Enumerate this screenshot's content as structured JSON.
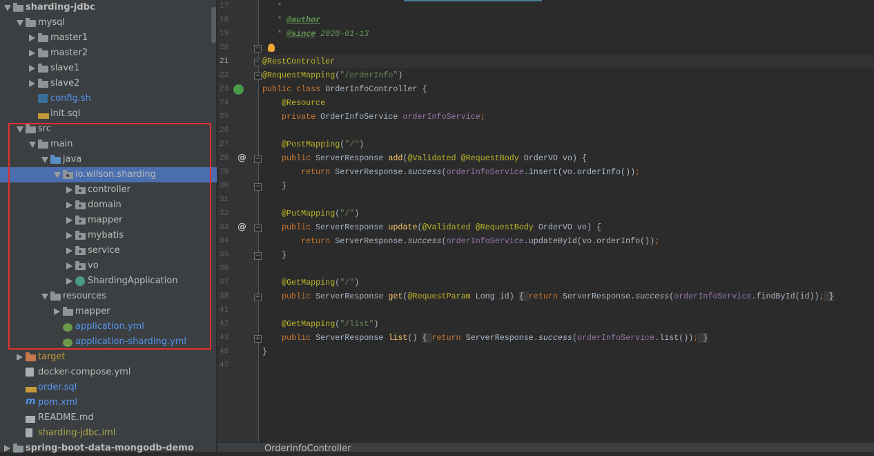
{
  "project_tree": [
    {
      "label": "sharding-jdbc",
      "level": 0,
      "arrow": "open",
      "icon": "module-folder",
      "color": "#bbbbbb",
      "bold": true
    },
    {
      "label": "mysql",
      "level": 1,
      "arrow": "open",
      "icon": "folder",
      "color": "#bbbbbb"
    },
    {
      "label": "master1",
      "level": 2,
      "arrow": "closed",
      "icon": "folder",
      "color": "#bbbbbb"
    },
    {
      "label": "master2",
      "level": 2,
      "arrow": "closed",
      "icon": "folder",
      "color": "#bbbbbb"
    },
    {
      "label": "slave1",
      "level": 2,
      "arrow": "closed",
      "icon": "folder",
      "color": "#bbbbbb"
    },
    {
      "label": "slave2",
      "level": 2,
      "arrow": "closed",
      "icon": "folder",
      "color": "#bbbbbb"
    },
    {
      "label": "config.sh",
      "level": 2,
      "arrow": "none",
      "icon": "shell-file",
      "color": "#5394ec"
    },
    {
      "label": "init.sql",
      "level": 2,
      "arrow": "none",
      "icon": "sql-file",
      "color": "#bbbbbb"
    },
    {
      "label": "src",
      "level": 1,
      "arrow": "open",
      "icon": "folder",
      "color": "#bbbbbb"
    },
    {
      "label": "main",
      "level": 2,
      "arrow": "open",
      "icon": "folder",
      "color": "#bbbbbb"
    },
    {
      "label": "java",
      "level": 3,
      "arrow": "open",
      "icon": "source-folder",
      "color": "#bbbbbb"
    },
    {
      "label": "io.wilson.sharding",
      "level": 4,
      "arrow": "open",
      "icon": "package",
      "color": "#bbbbbb",
      "selected": true
    },
    {
      "label": "controller",
      "level": 5,
      "arrow": "closed",
      "icon": "package",
      "color": "#bbbbbb"
    },
    {
      "label": "domain",
      "level": 5,
      "arrow": "closed",
      "icon": "package",
      "color": "#bbbbbb"
    },
    {
      "label": "mapper",
      "level": 5,
      "arrow": "closed",
      "icon": "package",
      "color": "#bbbbbb"
    },
    {
      "label": "mybatis",
      "level": 5,
      "arrow": "closed",
      "icon": "package",
      "color": "#bbbbbb"
    },
    {
      "label": "service",
      "level": 5,
      "arrow": "closed",
      "icon": "package",
      "color": "#bbbbbb"
    },
    {
      "label": "vo",
      "level": 5,
      "arrow": "closed",
      "icon": "package",
      "color": "#bbbbbb"
    },
    {
      "label": "ShardingApplication",
      "level": 5,
      "arrow": "closed",
      "icon": "spring-boot-class",
      "color": "#bbbbbb"
    },
    {
      "label": "resources",
      "level": 3,
      "arrow": "open",
      "icon": "resources-folder",
      "color": "#bbbbbb"
    },
    {
      "label": "mapper",
      "level": 4,
      "arrow": "closed",
      "icon": "folder",
      "color": "#bbbbbb"
    },
    {
      "label": "application.yml",
      "level": 4,
      "arrow": "none",
      "icon": "yml-file",
      "color": "#5394ec"
    },
    {
      "label": "application-sharding.yml",
      "level": 4,
      "arrow": "none",
      "icon": "yml-file",
      "color": "#5394ec"
    },
    {
      "label": "target",
      "level": 1,
      "arrow": "closed",
      "icon": "excluded-folder",
      "color": "#c49a3a"
    },
    {
      "label": "docker-compose.yml",
      "level": 1,
      "arrow": "none",
      "icon": "docker-compose-file",
      "color": "#bbbbbb"
    },
    {
      "label": "order.sql",
      "level": 1,
      "arrow": "none",
      "icon": "sql-file",
      "color": "#5394ec"
    },
    {
      "label": "pom.xml",
      "level": 1,
      "arrow": "none",
      "icon": "maven-file",
      "color": "#5394ec"
    },
    {
      "label": "README.md",
      "level": 1,
      "arrow": "none",
      "icon": "markdown-file",
      "color": "#bbbbbb"
    },
    {
      "label": "sharding-jdbc.iml",
      "level": 1,
      "arrow": "none",
      "icon": "iml-file",
      "color": "#a8a84a"
    },
    {
      "label": "spring-boot-data-mongodb-demo",
      "level": 0,
      "arrow": "closed",
      "icon": "module-folder",
      "color": "#bbbbbb",
      "bold": true
    }
  ],
  "editor": {
    "current_line": "21",
    "lines": [
      {
        "n": "17",
        "t": [
          [
            "   *",
            "c"
          ]
        ]
      },
      {
        "n": "18",
        "t": [
          [
            "   * ",
            "c"
          ],
          [
            "@author",
            "ct"
          ]
        ]
      },
      {
        "n": "19",
        "t": [
          [
            "   * ",
            "c"
          ],
          [
            "@since",
            "ct"
          ],
          [
            " 2020-01-13",
            "c"
          ]
        ]
      },
      {
        "n": "20",
        "t": [],
        "fold": "-",
        "gicon": "intention-bulb-icon"
      },
      {
        "n": "21",
        "t": [
          [
            "@RestController",
            "a"
          ]
        ],
        "fold": "-"
      },
      {
        "n": "22",
        "t": [
          [
            "@RequestMapping",
            "a"
          ],
          [
            "(",
            ""
          ],
          [
            "\"/orderInfo\"",
            "s"
          ],
          [
            ")",
            ""
          ]
        ],
        "fold": "-"
      },
      {
        "n": "23",
        "t": [
          [
            "public class ",
            "k"
          ],
          [
            "OrderInfoController {",
            ""
          ]
        ],
        "gicon": "spring-bean-icon"
      },
      {
        "n": "24",
        "t": [
          [
            "    @Resource",
            "a"
          ]
        ]
      },
      {
        "n": "25",
        "t": [
          [
            "    private ",
            "k"
          ],
          [
            "OrderInfoService ",
            ""
          ],
          [
            "orderInfoService",
            "f"
          ],
          [
            ";",
            "k"
          ]
        ]
      },
      {
        "n": "26",
        "t": []
      },
      {
        "n": "27",
        "t": [
          [
            "    @PostMapping",
            "a"
          ],
          [
            "(",
            ""
          ],
          [
            "\"/\"",
            "s"
          ],
          [
            ")",
            ""
          ]
        ]
      },
      {
        "n": "28",
        "t": [
          [
            "    public ",
            "k"
          ],
          [
            "ServerResponse ",
            ""
          ],
          [
            "add",
            "m"
          ],
          [
            "(",
            ""
          ],
          [
            "@Validated @RequestBody",
            "a"
          ],
          [
            " OrderVO vo) {",
            ""
          ]
        ],
        "fold": "-",
        "gicon": "at-mapping-icon"
      },
      {
        "n": "29",
        "t": [
          [
            "        return ",
            "k"
          ],
          [
            "ServerResponse.",
            ""
          ],
          [
            "success",
            "i"
          ],
          [
            "(",
            ""
          ],
          [
            "orderInfoService",
            "f"
          ],
          [
            ".insert(vo.orderInfo())",
            ""
          ],
          [
            ";",
            "k"
          ]
        ]
      },
      {
        "n": "30",
        "t": [
          [
            "    }",
            ""
          ]
        ],
        "fold": "-"
      },
      {
        "n": "31",
        "t": []
      },
      {
        "n": "32",
        "t": [
          [
            "    @PutMapping",
            "a"
          ],
          [
            "(",
            ""
          ],
          [
            "\"/\"",
            "s"
          ],
          [
            ")",
            ""
          ]
        ]
      },
      {
        "n": "33",
        "t": [
          [
            "    public ",
            "k"
          ],
          [
            "ServerResponse ",
            ""
          ],
          [
            "update",
            "m"
          ],
          [
            "(",
            ""
          ],
          [
            "@Validated @RequestBody",
            "a"
          ],
          [
            " OrderVO vo) {",
            ""
          ]
        ],
        "fold": "-",
        "gicon": "at-mapping-icon"
      },
      {
        "n": "34",
        "t": [
          [
            "        return ",
            "k"
          ],
          [
            "ServerResponse.",
            ""
          ],
          [
            "success",
            "i"
          ],
          [
            "(",
            ""
          ],
          [
            "orderInfoService",
            "f"
          ],
          [
            ".updateById(vo.orderInfo())",
            ""
          ],
          [
            ";",
            "k"
          ]
        ]
      },
      {
        "n": "35",
        "t": [
          [
            "    }",
            ""
          ]
        ],
        "fold": "-"
      },
      {
        "n": "36",
        "t": []
      },
      {
        "n": "37",
        "t": [
          [
            "    @GetMapping",
            "a"
          ],
          [
            "(",
            ""
          ],
          [
            "\"/\"",
            "s"
          ],
          [
            ")",
            ""
          ]
        ]
      },
      {
        "n": "38",
        "t": [
          [
            "    public ",
            "k"
          ],
          [
            "ServerResponse ",
            ""
          ],
          [
            "get",
            "m"
          ],
          [
            "(",
            ""
          ],
          [
            "@RequestParam",
            "a"
          ],
          [
            " Long id) ",
            ""
          ],
          [
            "{ ",
            "b"
          ],
          [
            "return ",
            "k"
          ],
          [
            "ServerResponse.",
            ""
          ],
          [
            "success",
            "i"
          ],
          [
            "(",
            ""
          ],
          [
            "orderInfoService",
            "f"
          ],
          [
            ".findById(id))",
            ""
          ],
          [
            ";",
            "k"
          ],
          [
            " }",
            "b"
          ]
        ],
        "fold": "+"
      },
      {
        "n": "41",
        "t": []
      },
      {
        "n": "42",
        "t": [
          [
            "    @GetMapping",
            "a"
          ],
          [
            "(",
            ""
          ],
          [
            "\"/list\"",
            "s"
          ],
          [
            ")",
            ""
          ]
        ]
      },
      {
        "n": "43",
        "t": [
          [
            "    public ",
            "k"
          ],
          [
            "ServerResponse ",
            ""
          ],
          [
            "list",
            "m"
          ],
          [
            "() ",
            ""
          ],
          [
            "{ ",
            "b"
          ],
          [
            "return ",
            "k"
          ],
          [
            "ServerResponse.",
            ""
          ],
          [
            "success",
            "i"
          ],
          [
            "(",
            ""
          ],
          [
            "orderInfoService",
            "f"
          ],
          [
            ".list())",
            ""
          ],
          [
            ";",
            "k"
          ],
          [
            " }",
            "b"
          ]
        ],
        "fold": "+"
      },
      {
        "n": "46",
        "t": [
          [
            "}",
            ""
          ]
        ]
      },
      {
        "n": "47",
        "t": []
      }
    ]
  },
  "breadcrumb": {
    "label": "OrderInfoController"
  },
  "colors": {
    "selection": "#4b6eaf",
    "highlight_box": "#e0312f",
    "keyword": "#cc7832",
    "annotation": "#bbb529",
    "string": "#6a8759",
    "field": "#9876aa"
  }
}
